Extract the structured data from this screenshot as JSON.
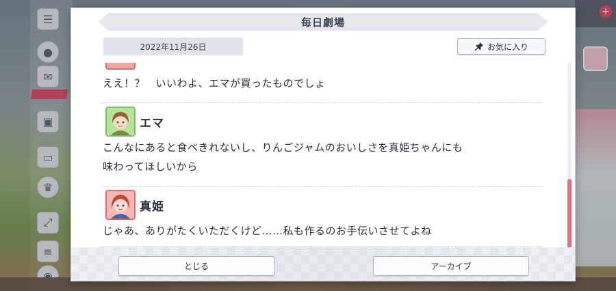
{
  "dialog": {
    "title": "毎日劇場",
    "date": "2022年11月26日",
    "favorite_label": "お気に入り",
    "close_label": "とじる",
    "archive_label": "アーカイブ"
  },
  "messages": [
    {
      "speaker": "",
      "lines": [
        "ええ！？　いいわよ、エマが買ったものでしょ"
      ]
    },
    {
      "speaker": "エマ",
      "lines": [
        "こんなにあると食べきれないし、りんごジャムのおいしさを真姫ちゃんにも",
        "味わってほしいから"
      ]
    },
    {
      "speaker": "真姫",
      "lines": [
        "じゃあ、ありがたくいただくけど……私も作るのお手伝いさせてよね"
      ]
    }
  ],
  "colors": {
    "accent": "#ea6c83",
    "emma_frame": "#7fc063",
    "maki_frame": "#e56b6b"
  },
  "icons": {
    "favorite": "pin-icon"
  }
}
